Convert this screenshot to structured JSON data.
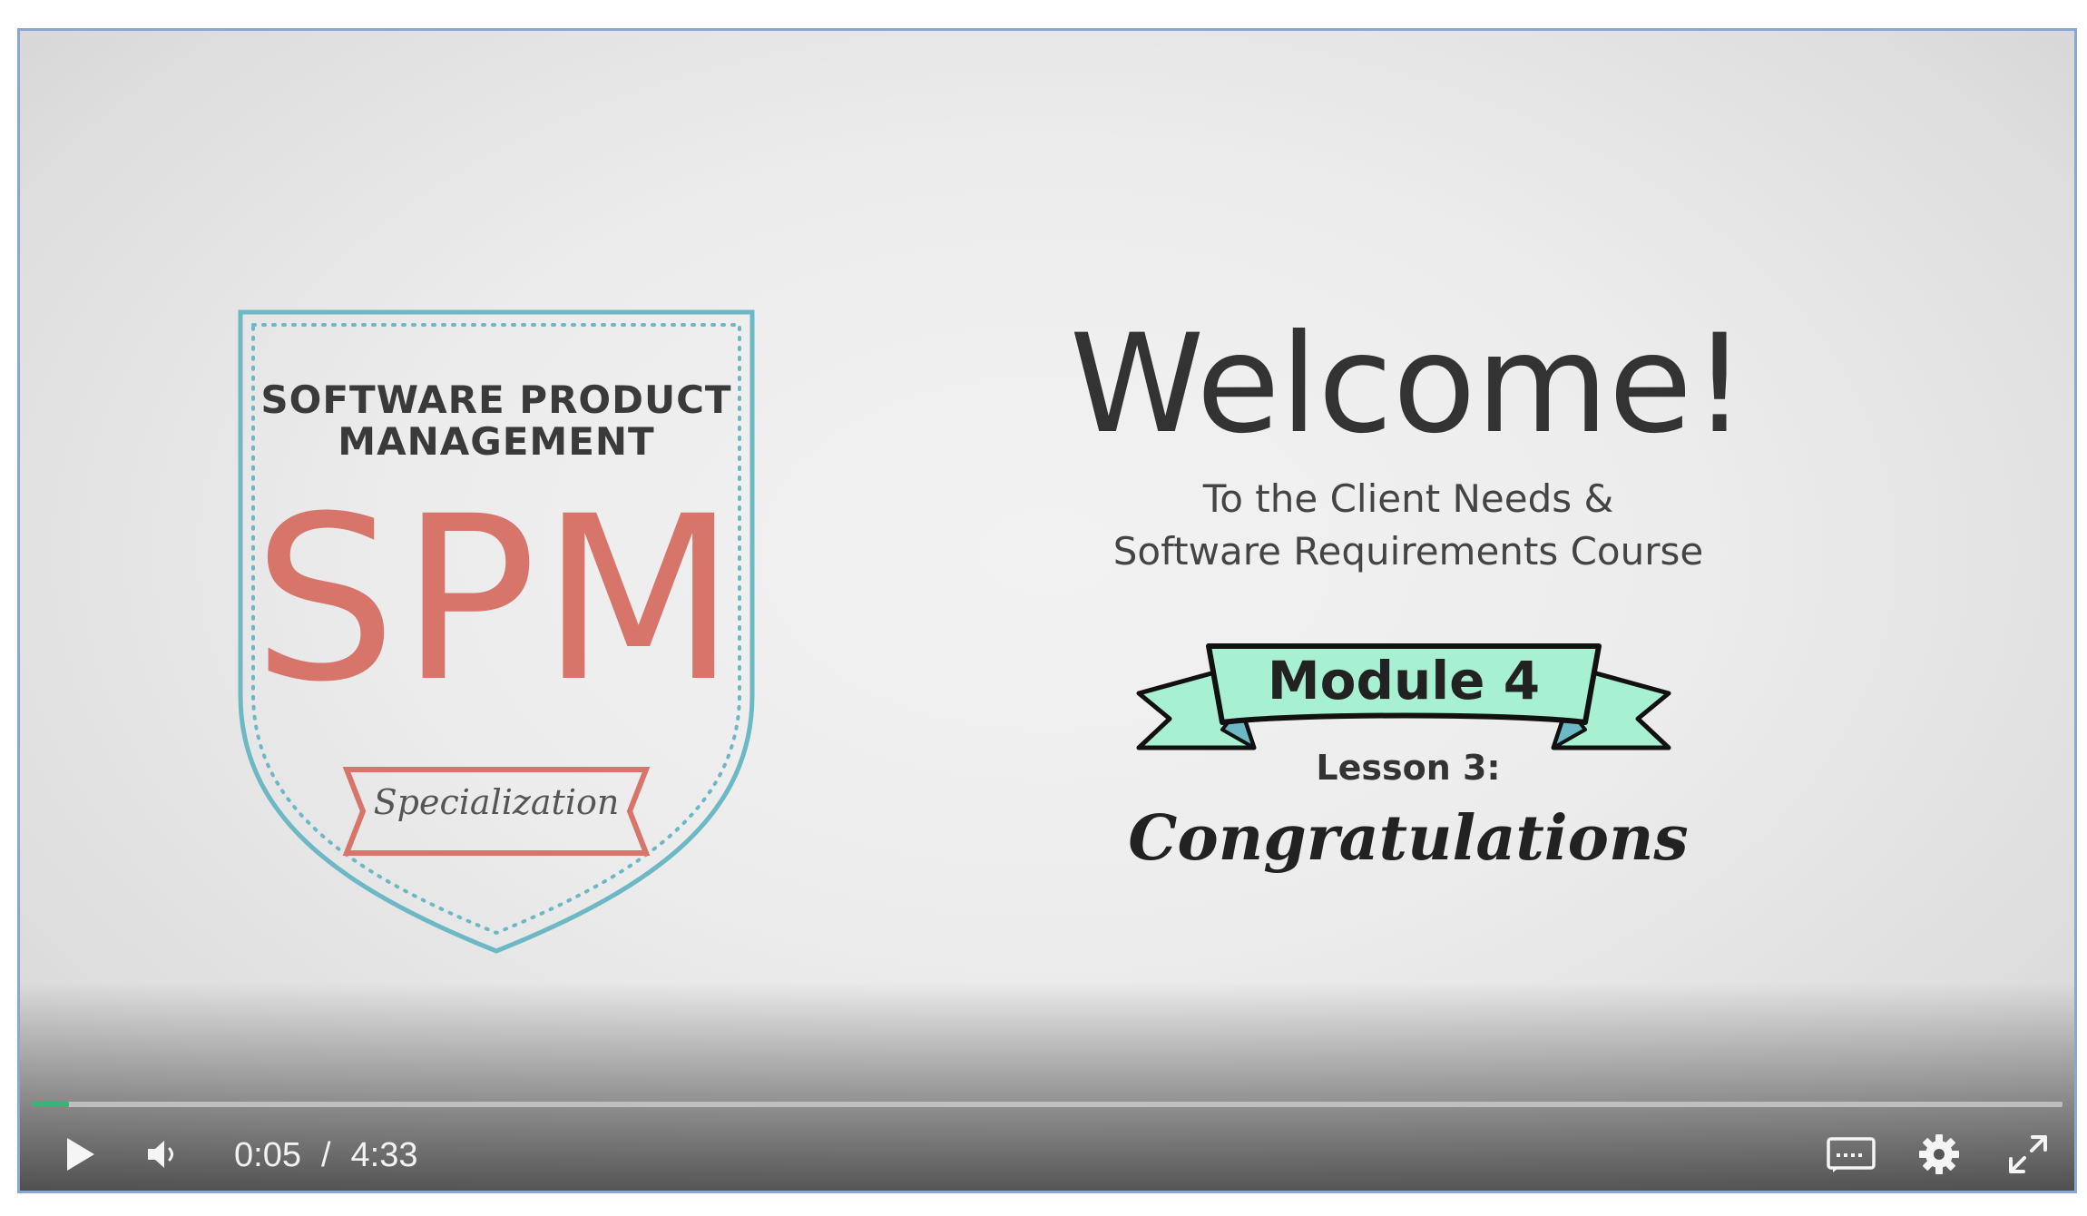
{
  "video": {
    "badge": {
      "title_line1": "SOFTWARE PRODUCT",
      "title_line2": "MANAGEMENT",
      "abbreviation": "SPM",
      "ribbon_text": "Specialization",
      "outline_color": "#6cb8c4",
      "accent_color": "#d7756a"
    },
    "welcome": "Welcome!",
    "subtitle_line1": "To the Client Needs &",
    "subtitle_line2": "Software Requirements Course",
    "module": "Module 4",
    "module_ribbon_color": "#a8f0d2",
    "lesson": "Lesson 3:",
    "lesson_title": "Congratulations"
  },
  "player": {
    "current_time": "0:05",
    "separator": "/",
    "duration": "4:33",
    "progress_fraction": 0.0183,
    "progress_color": "#3ab27a",
    "icons": {
      "play": "play-icon",
      "volume": "volume-icon",
      "captions": "captions-icon",
      "settings": "gear-icon",
      "fullscreen": "fullscreen-icon"
    }
  }
}
